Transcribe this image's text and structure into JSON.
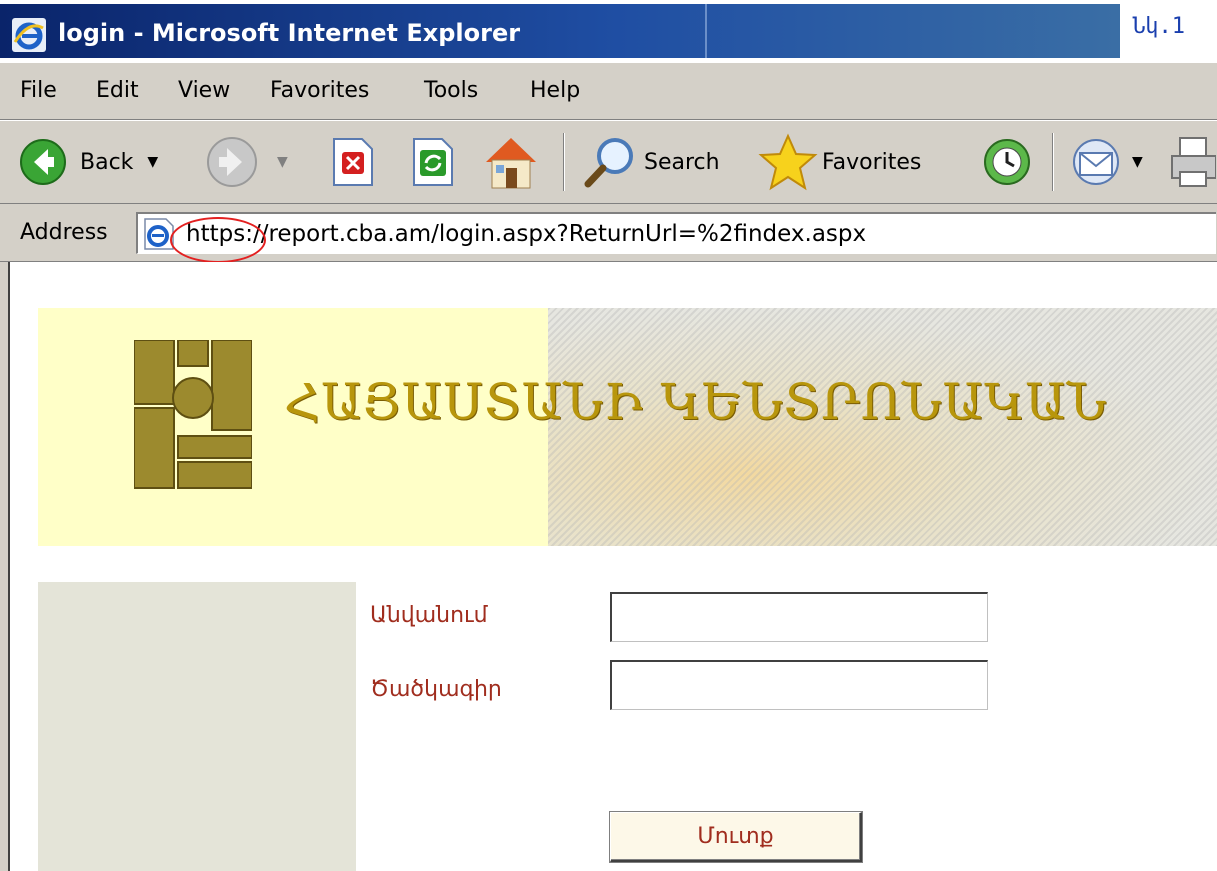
{
  "window": {
    "title": "login - Microsoft Internet Explorer",
    "corner_label": "Նկ.1"
  },
  "menu": {
    "items": [
      {
        "label": "File"
      },
      {
        "label": "Edit"
      },
      {
        "label": "View"
      },
      {
        "label": "Favorites"
      },
      {
        "label": "Tools"
      },
      {
        "label": "Help"
      }
    ]
  },
  "toolbar": {
    "back_label": "Back",
    "search_label": "Search",
    "favorites_label": "Favorites",
    "icons": [
      "back-arrow-icon",
      "forward-arrow-icon",
      "stop-icon",
      "refresh-icon",
      "home-icon",
      "search-magnifier-icon",
      "favorites-star-icon",
      "history-icon",
      "mail-icon",
      "print-icon"
    ]
  },
  "address": {
    "label": "Address",
    "url": "https://report.cba.am/login.aspx?ReturnUrl=%2findex.aspx"
  },
  "banner": {
    "title": "ՀԱՅԱՍՏԱՆԻ ԿԵՆՏՐՈՆԱԿԱՆ"
  },
  "form": {
    "username_label": "Անվանում",
    "password_label": "Ծածկագիր",
    "username_value": "",
    "password_value": "",
    "submit_label": "Մուտք"
  },
  "colors": {
    "title_bar": "#0a246a",
    "chrome": "#d4d0c8",
    "banner_bg": "#ffffc8",
    "banner_text": "#b8960c",
    "form_label": "#a02d1e",
    "left_panel": "#e4e4d8",
    "highlight_ring": "#e32020"
  }
}
